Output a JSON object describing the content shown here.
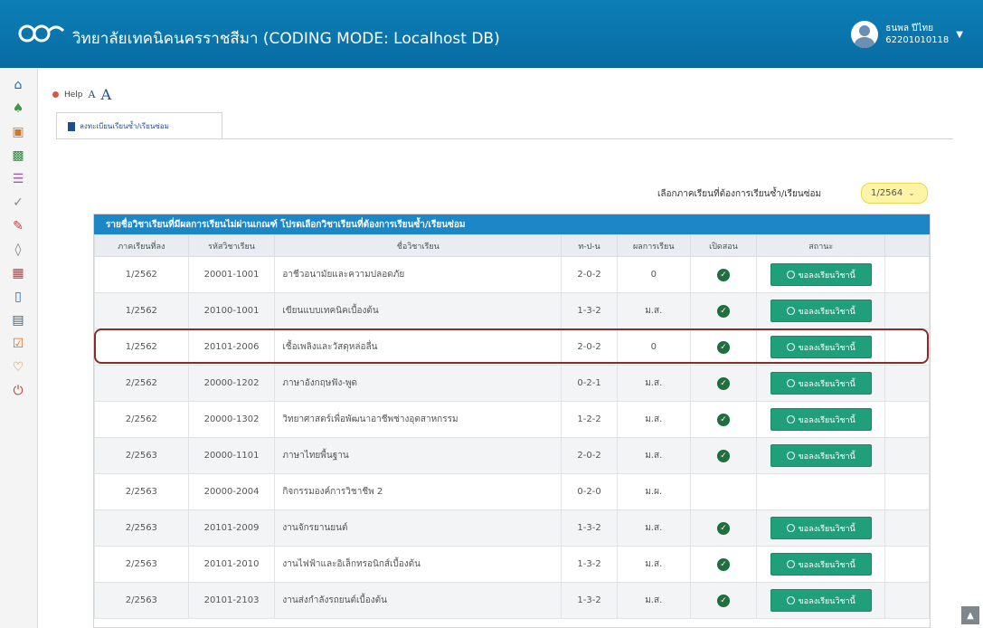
{
  "header": {
    "logo_text": "edr",
    "title": "วิทยาลัยเทคนิคนครราชสีมา (CODING MODE: Localhost DB)",
    "user_name": "ธนพล ปีไทย",
    "user_id": "62201010118"
  },
  "toolbar": {
    "help_label": "Help",
    "font_small": "A",
    "font_large": "A"
  },
  "tab": {
    "label": "ลงทะเบียนเรียนซ้ำ/เรียนซ่อม"
  },
  "semester": {
    "label": "เลือกภาคเรียนที่ต้องการเรียนซ้ำ/เรียนซ่อม",
    "value": "1/2564"
  },
  "table": {
    "title": "รายชื่อวิชาเรียนที่มีผลการเรียนไม่ผ่านเกณฑ์ โปรดเลือกวิชาเรียนที่ต้องการเรียนซ้ำ/เรียนซ่อม",
    "columns": [
      "ภาคเรียนที่ลง",
      "รหัสวิชาเรียน",
      "ชื่อวิชาเรียน",
      "ท-ป-น",
      "ผลการเรียน",
      "เปิดสอน",
      "สถานะ"
    ],
    "button_label": "ขอลงเรียนวิชานี้",
    "rows": [
      {
        "sem": "1/2562",
        "code": "20001-1001",
        "name": "อาชีวอนามัยและความปลอดภัย",
        "tpn": "2-0-2",
        "grade": "0"
      },
      {
        "sem": "1/2562",
        "code": "20100-1001",
        "name": "เขียนแบบเทคนิคเบื้องต้น",
        "tpn": "1-3-2",
        "grade": "ม.ส."
      },
      {
        "sem": "1/2562",
        "code": "20101-2006",
        "name": "เชื้อเพลิงและวัสดุหล่อลื่น",
        "tpn": "2-0-2",
        "grade": "0"
      },
      {
        "sem": "2/2562",
        "code": "20000-1202",
        "name": "ภาษาอังกฤษฟัง-พูด",
        "tpn": "0-2-1",
        "grade": "ม.ส."
      },
      {
        "sem": "2/2562",
        "code": "20000-1302",
        "name": "วิทยาศาสตร์เพื่อพัฒนาอาชีพช่างอุตสาหกรรม",
        "tpn": "1-2-2",
        "grade": "ม.ส."
      },
      {
        "sem": "2/2563",
        "code": "20000-1101",
        "name": "ภาษาไทยพื้นฐาน",
        "tpn": "2-0-2",
        "grade": "ม.ส."
      },
      {
        "sem": "2/2563",
        "code": "20000-2004",
        "name": "กิจกรรมองค์การวิชาชีพ 2",
        "tpn": "0-2-0",
        "grade": "ม.ผ."
      },
      {
        "sem": "2/2563",
        "code": "20101-2009",
        "name": "งานจักรยานยนต์",
        "tpn": "1-3-2",
        "grade": "ม.ส."
      },
      {
        "sem": "2/2563",
        "code": "20101-2010",
        "name": "งานไฟฟ้าและอิเล็กทรอนิกส์เบื้องต้น",
        "tpn": "1-3-2",
        "grade": "ม.ส."
      },
      {
        "sem": "2/2563",
        "code": "20101-2103",
        "name": "งานส่งกำลังรถยนต์เบื้องต้น",
        "tpn": "1-3-2",
        "grade": "ม.ส."
      }
    ]
  },
  "colors": {
    "header_blue": "#0d7fb6",
    "table_header_blue": "#1c86c6",
    "button_green": "#20a07a",
    "highlight": "#8a2a2a",
    "semester_select": "#fff3a8"
  },
  "icons": [
    "home-icon",
    "user-icon",
    "book-icon",
    "chart-icon",
    "list-icon",
    "check-icon",
    "pencil-icon",
    "eraser-icon",
    "table-icon",
    "document-icon",
    "card-icon",
    "form-icon",
    "heart-icon",
    "power-icon"
  ]
}
